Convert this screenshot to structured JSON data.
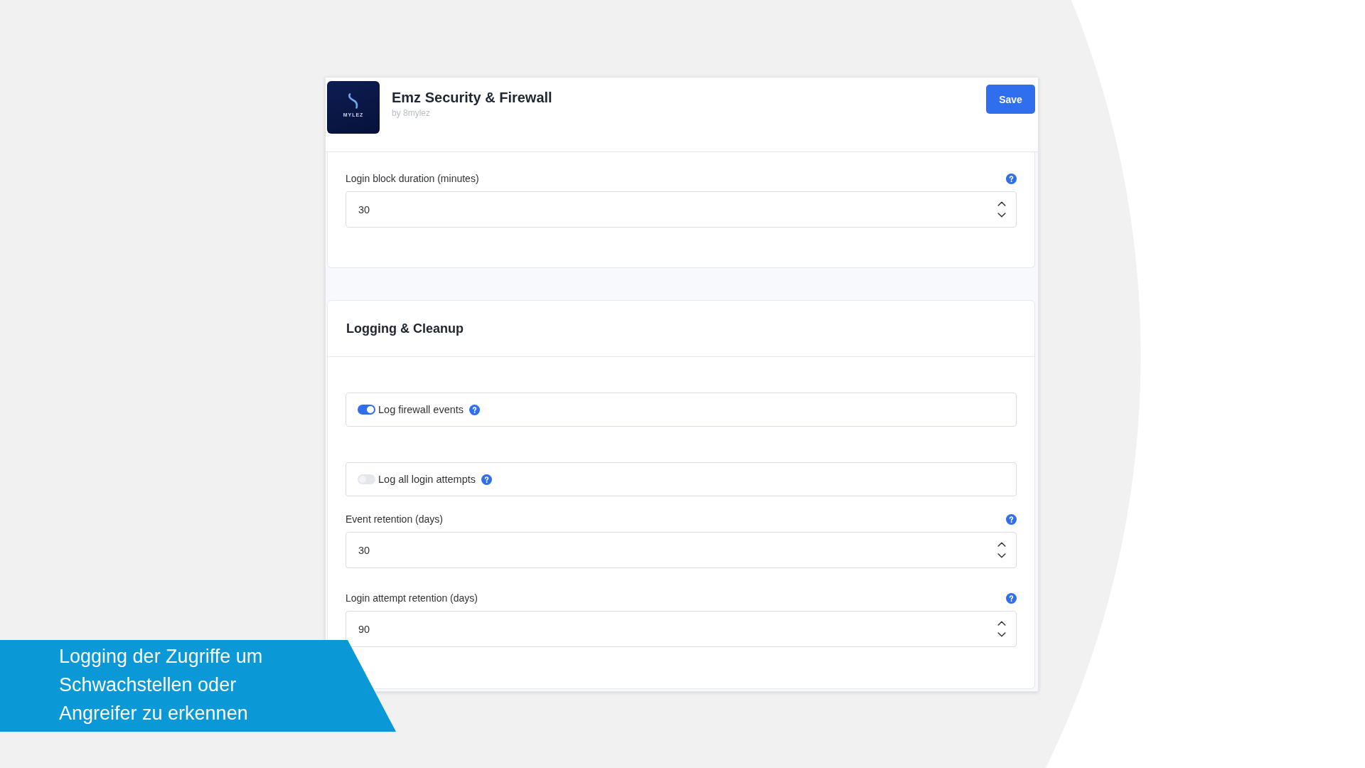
{
  "app": {
    "logo_text": "MYLEZ",
    "title": "Emz Security & Firewall",
    "author": "by 8mylez",
    "save_label": "Save"
  },
  "sections": [
    {
      "items": [
        {
          "kind": "number",
          "label": "Login block duration (minutes)",
          "value": "30"
        }
      ]
    },
    {
      "title": "Logging & Cleanup",
      "items": [
        {
          "kind": "toggle",
          "label": "Log firewall events",
          "on": true
        },
        {
          "kind": "toggle",
          "label": "Log all login attempts",
          "on": false
        },
        {
          "kind": "number",
          "label": "Event retention (days)",
          "value": "30"
        },
        {
          "kind": "number",
          "label": "Login attempt retention (days)",
          "value": "90"
        }
      ]
    }
  ],
  "caption": {
    "lines": [
      "Logging der Zugriffe um",
      "Schwachstellen oder",
      "Angreifer zu erkennen"
    ]
  }
}
